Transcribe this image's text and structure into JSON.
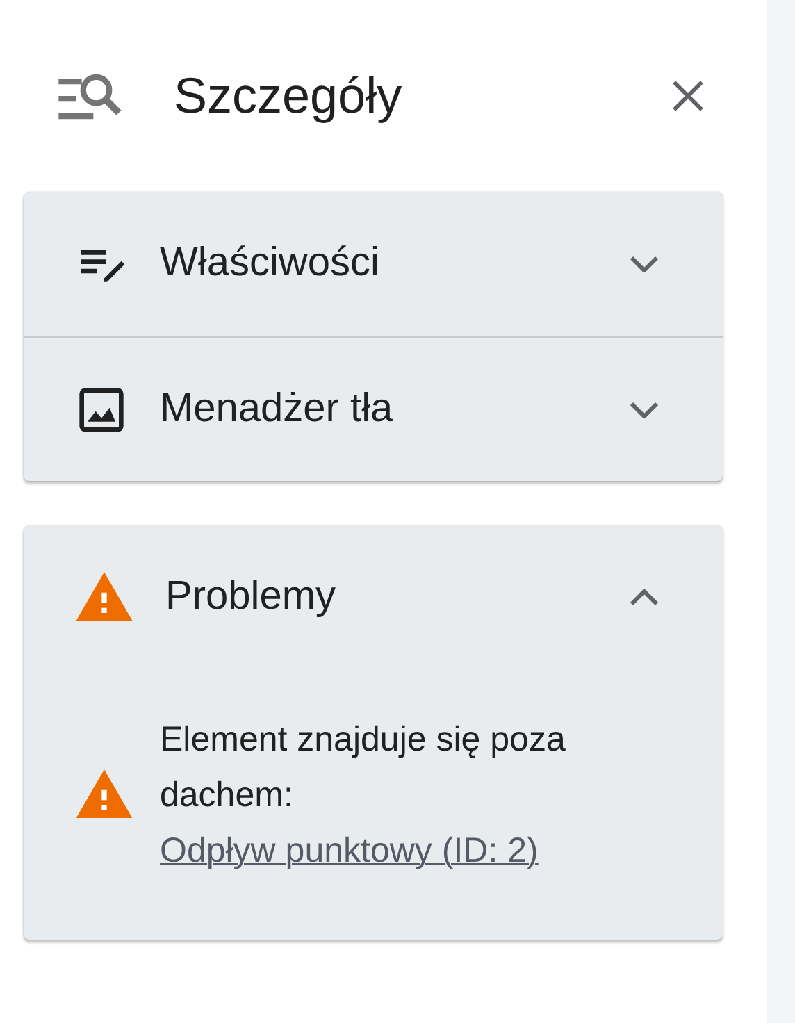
{
  "header": {
    "title": "Szczegóły"
  },
  "sections": [
    {
      "title": "Właściwości",
      "kind": "edit-list",
      "expanded": false
    },
    {
      "title": "Menadżer tła",
      "kind": "image",
      "expanded": false
    }
  ],
  "problems": {
    "title": "Problemy",
    "expanded": true,
    "items": [
      {
        "text": "Element znajduje się poza dachem:",
        "link": "Odpływ punktowy (ID: 2)"
      }
    ]
  }
}
